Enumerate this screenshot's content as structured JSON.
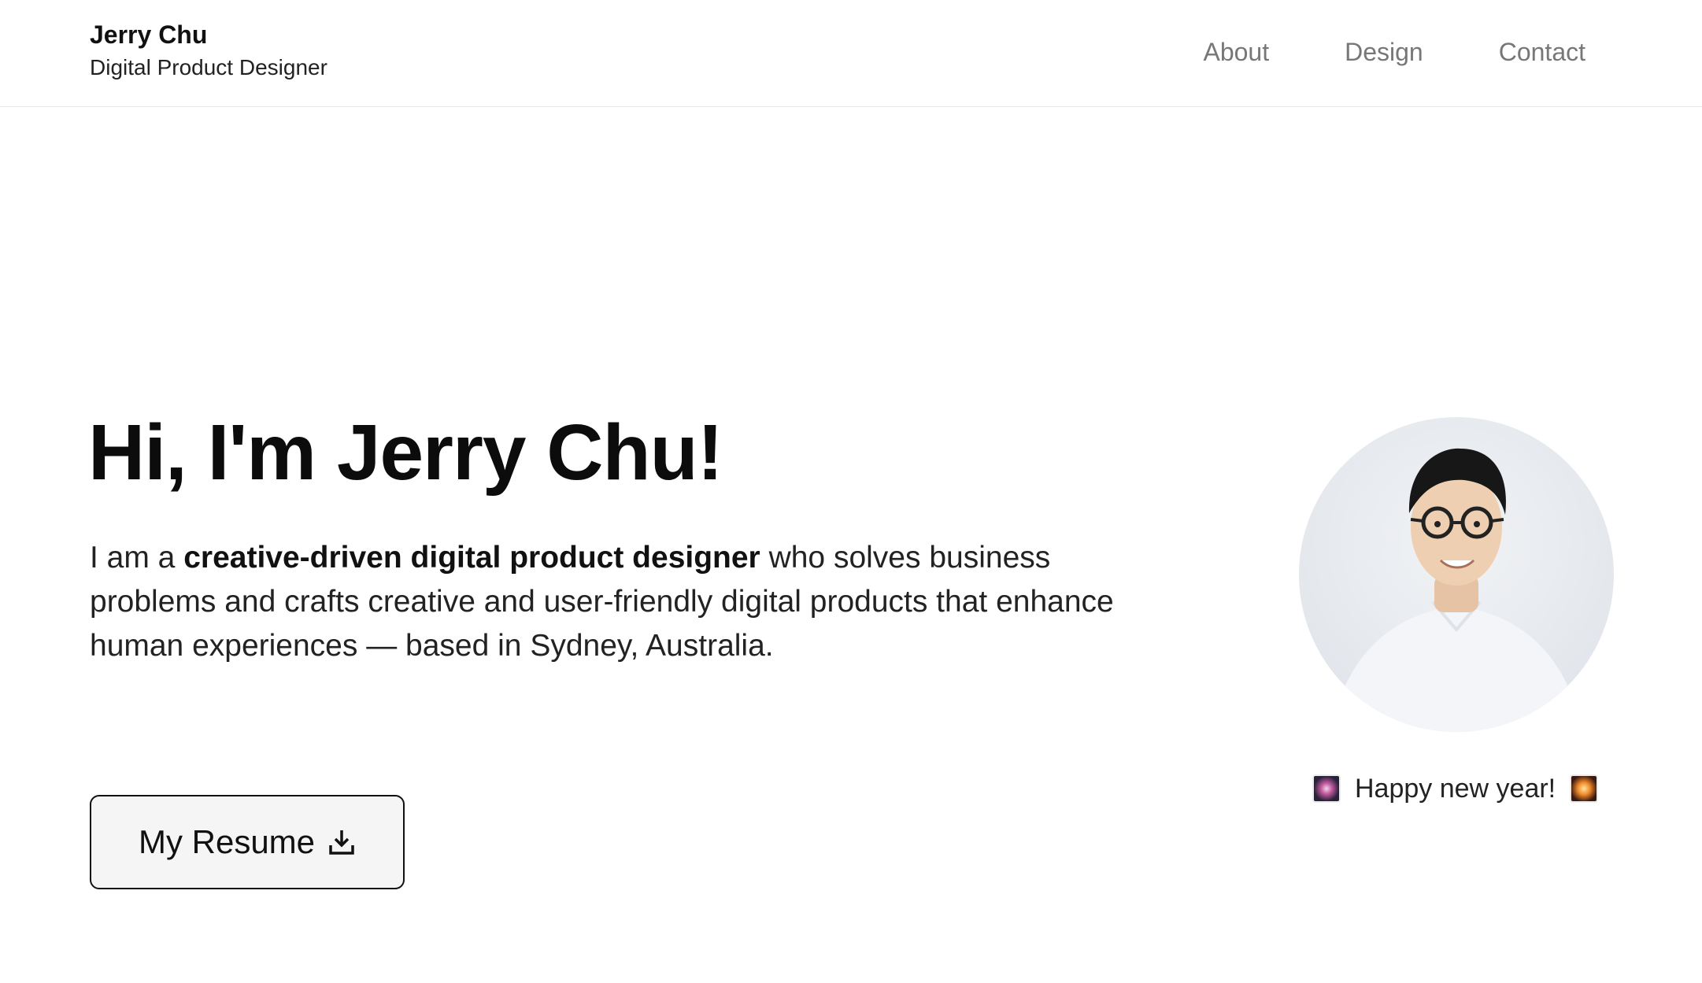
{
  "header": {
    "name": "Jerry Chu",
    "role": "Digital Product Designer",
    "nav": [
      "About",
      "Design",
      "Contact"
    ]
  },
  "hero": {
    "title": "Hi, I'm Jerry Chu!",
    "intro_prefix": "I am a ",
    "intro_bold": "creative-driven digital product designer",
    "intro_suffix": " who solves business problems and crafts creative and user-friendly digital products that enhance human experiences — based in Sydney, Australia.",
    "resume_label": "My Resume"
  },
  "greeting": {
    "text": "Happy new year!",
    "left_icon": "fireworks-icon",
    "right_icon": "firework-burst-icon"
  },
  "icons": {
    "resume": "download-icon"
  },
  "colors": {
    "nav_text": "#777777",
    "button_bg": "#f5f5f5",
    "button_border": "#111111"
  }
}
